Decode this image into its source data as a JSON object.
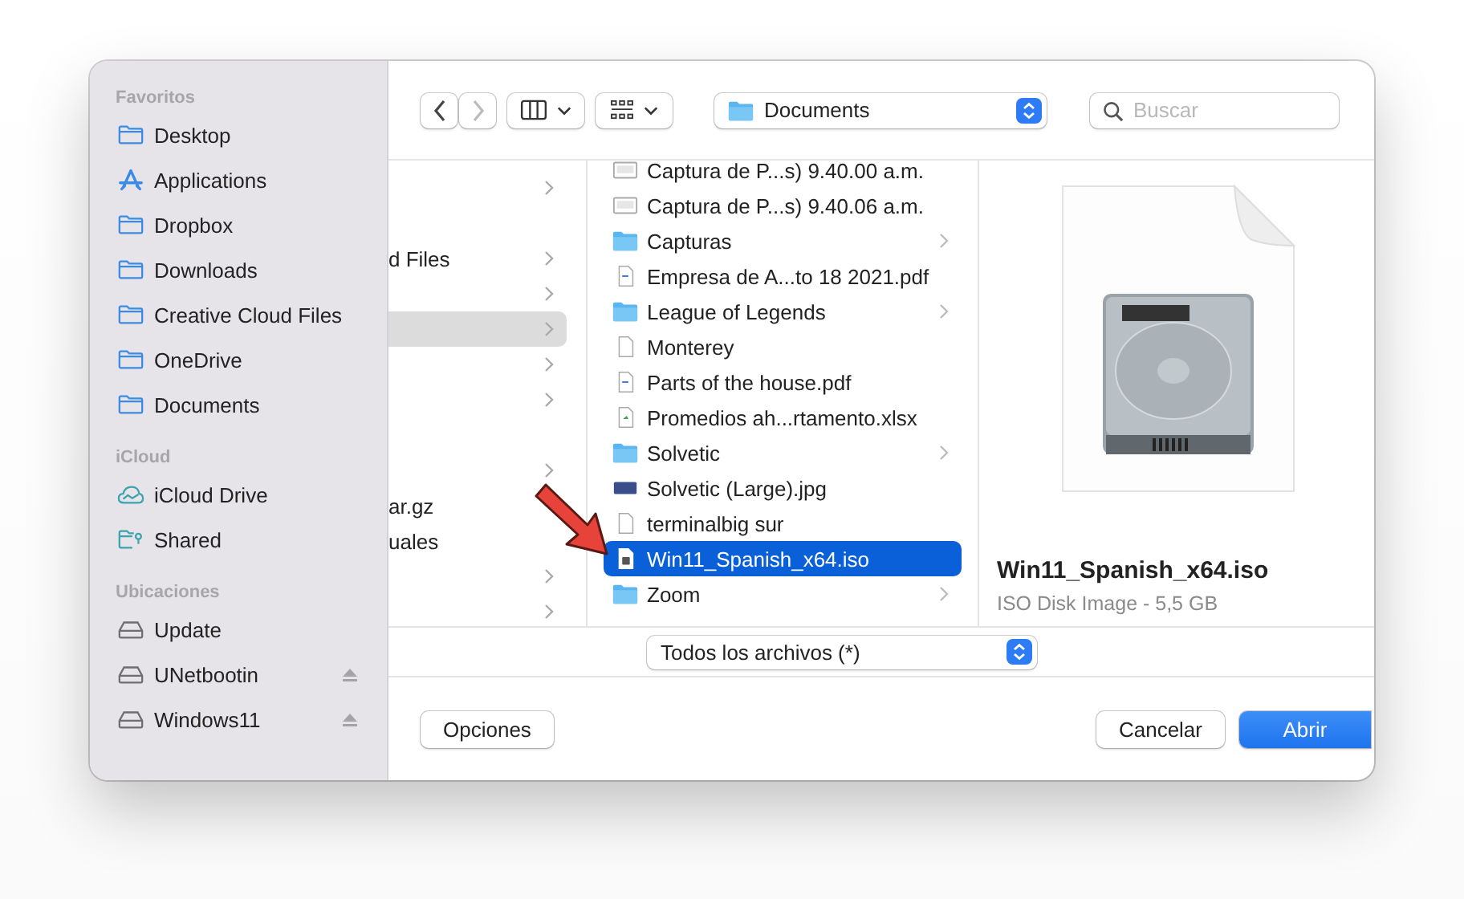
{
  "sidebar": {
    "sections": [
      {
        "title": "Favoritos",
        "items": [
          {
            "label": "Desktop",
            "kind": "folder",
            "eject": false,
            "selected": false
          },
          {
            "label": "Applications",
            "kind": "apps",
            "eject": false,
            "selected": false
          },
          {
            "label": "Dropbox",
            "kind": "folder",
            "eject": false,
            "selected": false
          },
          {
            "label": "Downloads",
            "kind": "folder",
            "eject": false,
            "selected": false
          },
          {
            "label": "Creative Cloud Files",
            "kind": "folder",
            "eject": false,
            "selected": false
          },
          {
            "label": "OneDrive",
            "kind": "folder",
            "eject": false,
            "selected": false
          },
          {
            "label": "Documents",
            "kind": "folder",
            "eject": false,
            "selected": false
          }
        ]
      },
      {
        "title": "iCloud",
        "items": [
          {
            "label": "iCloud Drive",
            "kind": "cloud",
            "eject": false,
            "selected": false
          },
          {
            "label": "Shared",
            "kind": "shared",
            "eject": false,
            "selected": false
          }
        ]
      },
      {
        "title": "Ubicaciones",
        "items": [
          {
            "label": "Update",
            "kind": "drive",
            "eject": false,
            "selected": false
          },
          {
            "label": "UNetbootin",
            "kind": "drive",
            "eject": true,
            "selected": false
          },
          {
            "label": "Windows11",
            "kind": "drive",
            "eject": true,
            "selected": false
          }
        ]
      }
    ]
  },
  "toolbar": {
    "location": "Documents",
    "search": {
      "placeholder": "Buscar"
    }
  },
  "column_1": [
    {
      "chevron": true,
      "selected": false
    },
    {
      "chevron": false,
      "selected": false
    },
    {
      "label": "d Files",
      "chevron": true,
      "selected": false
    },
    {
      "chevron": true,
      "selected": false
    },
    {
      "chevron": true,
      "selected": true
    },
    {
      "chevron": true,
      "selected": false
    },
    {
      "chevron": true,
      "selected": false
    },
    {
      "chevron": false,
      "selected": false
    },
    {
      "chevron": true,
      "selected": false
    },
    {
      "label": "ar.gz",
      "chevron": false,
      "selected": false
    },
    {
      "label": "uales",
      "chevron": false,
      "selected": false
    },
    {
      "chevron": true,
      "selected": false
    },
    {
      "chevron": true,
      "selected": false
    }
  ],
  "column_2": [
    {
      "label": "Captura de P...s) 9.40.00 a.m.",
      "kind": "screenshot",
      "selected": false
    },
    {
      "label": "Captura de P...s) 9.40.06 a.m.",
      "kind": "screenshot",
      "selected": false
    },
    {
      "label": "Capturas",
      "kind": "folder",
      "selected": false
    },
    {
      "label": "Empresa de A...to 18 2021.pdf",
      "kind": "pdf",
      "selected": false
    },
    {
      "label": "League of Legends",
      "kind": "folder",
      "selected": false
    },
    {
      "label": "Monterey",
      "kind": "document",
      "selected": false
    },
    {
      "label": "Parts of the house.pdf",
      "kind": "pdf",
      "selected": false
    },
    {
      "label": "Promedios ah...rtamento.xlsx",
      "kind": "spreadsheet",
      "selected": false
    },
    {
      "label": "Solvetic",
      "kind": "folder",
      "selected": false
    },
    {
      "label": "Solvetic (Large).jpg",
      "kind": "image",
      "selected": false
    },
    {
      "label": "terminalbig sur",
      "kind": "document",
      "selected": false
    },
    {
      "label": "Win11_Spanish_x64.iso",
      "kind": "disk",
      "selected": true
    },
    {
      "label": "Zoom",
      "kind": "folder",
      "selected": false
    }
  ],
  "preview": {
    "name": "Win11_Spanish_x64.iso",
    "info": "ISO Disk Image - 5,5 GB"
  },
  "filter": "Todos los archivos (*)",
  "buttons": [
    {
      "label": "Opciones",
      "kind": "secondary"
    },
    {
      "label": "Cancelar",
      "kind": "secondary"
    },
    {
      "label": "Abrir",
      "kind": "primary"
    }
  ]
}
